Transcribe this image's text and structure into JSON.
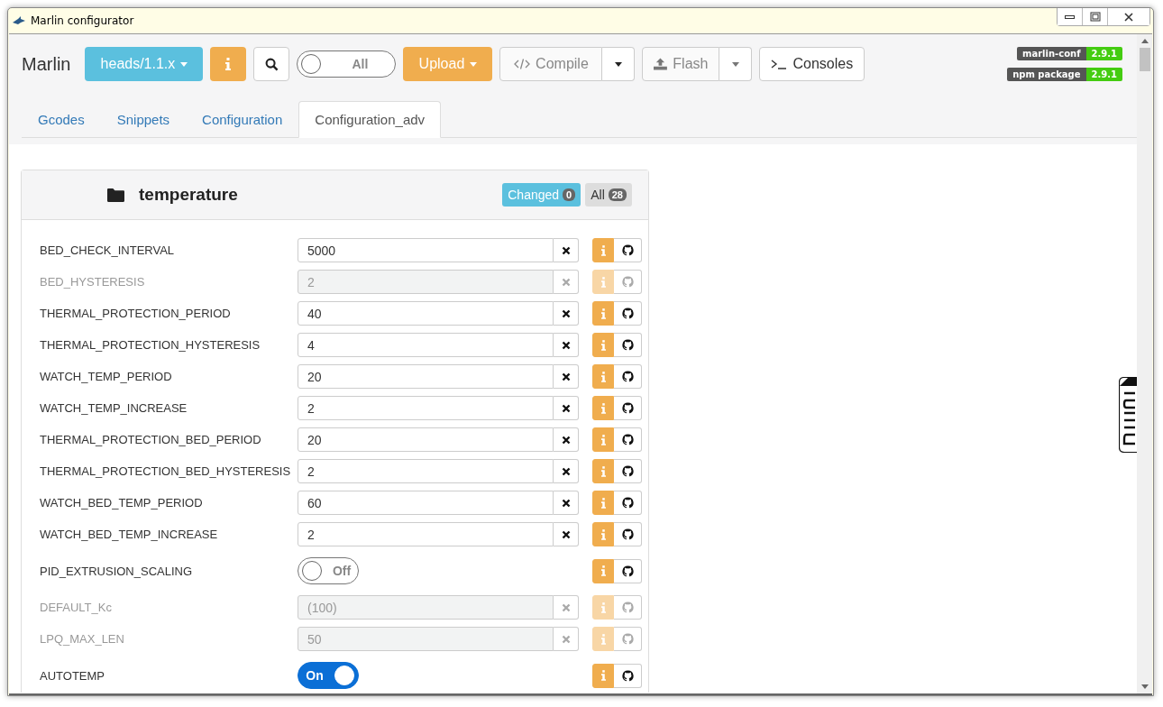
{
  "window": {
    "title": "Marlin configurator"
  },
  "brand": "Marlin",
  "toolbar": {
    "branch": "heads/1.1.x",
    "filter_toggle": {
      "label": "All",
      "on": false
    },
    "upload": "Upload",
    "compile": "Compile",
    "flash": "Flash",
    "consoles": "Consoles"
  },
  "version_badges": [
    {
      "label": "marlin-conf",
      "version": "2.9.1"
    },
    {
      "label": "npm package",
      "version": "2.9.1"
    }
  ],
  "tabs": [
    {
      "label": "Gcodes",
      "selected": false
    },
    {
      "label": "Snippets",
      "selected": false
    },
    {
      "label": "Configuration",
      "selected": false
    },
    {
      "label": "Configuration_adv",
      "selected": true
    }
  ],
  "section": {
    "title": "temperature",
    "filters": [
      {
        "label": "Changed",
        "count": "0",
        "selected": true
      },
      {
        "label": "All",
        "count": "28",
        "selected": false
      }
    ],
    "options": [
      {
        "kind": "field",
        "name": "BED_CHECK_INTERVAL",
        "value": "5000",
        "disabled": false
      },
      {
        "kind": "field",
        "name": "BED_HYSTERESIS",
        "value": "2",
        "disabled": true
      },
      {
        "kind": "field",
        "name": "THERMAL_PROTECTION_PERIOD",
        "value": "40",
        "disabled": false
      },
      {
        "kind": "field",
        "name": "THERMAL_PROTECTION_HYSTERESIS",
        "value": "4",
        "disabled": false
      },
      {
        "kind": "field",
        "name": "WATCH_TEMP_PERIOD",
        "value": "20",
        "disabled": false
      },
      {
        "kind": "field",
        "name": "WATCH_TEMP_INCREASE",
        "value": "2",
        "disabled": false
      },
      {
        "kind": "field",
        "name": "THERMAL_PROTECTION_BED_PERIOD",
        "value": "20",
        "disabled": false
      },
      {
        "kind": "field",
        "name": "THERMAL_PROTECTION_BED_HYSTERESIS",
        "value": "2",
        "disabled": false
      },
      {
        "kind": "field",
        "name": "WATCH_BED_TEMP_PERIOD",
        "value": "60",
        "disabled": false
      },
      {
        "kind": "field",
        "name": "WATCH_BED_TEMP_INCREASE",
        "value": "2",
        "disabled": false
      },
      {
        "kind": "switch",
        "name": "PID_EXTRUSION_SCALING",
        "label": "Off",
        "on": false,
        "disabled": false
      },
      {
        "kind": "field",
        "name": "DEFAULT_Kc",
        "value": "(100)",
        "disabled": true
      },
      {
        "kind": "field",
        "name": "LPQ_MAX_LEN",
        "value": "50",
        "disabled": true
      },
      {
        "kind": "switch",
        "name": "AUTOTEMP",
        "label": "On",
        "on": true,
        "disabled": false
      }
    ]
  }
}
